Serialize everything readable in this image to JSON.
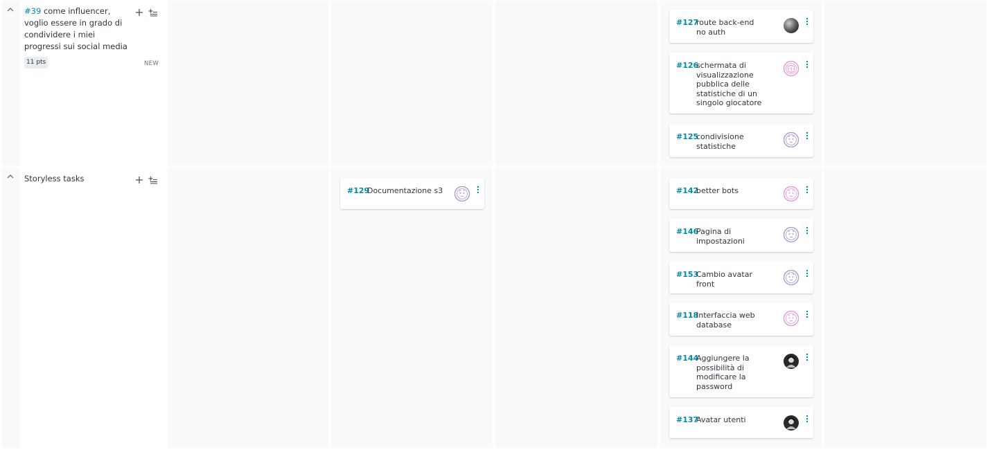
{
  "swimlanes": [
    {
      "story_ref": "#39",
      "story_title": "come influencer, voglio essere in grado di condividere i miei progressi sui social media",
      "points": "11 pts",
      "status": "NEW"
    },
    {
      "title": "Storyless tasks"
    }
  ],
  "cards": [
    {
      "ref": "#127",
      "title": "route back-end no auth",
      "avatar": "dark-sphere"
    },
    {
      "ref": "#126",
      "title": "schermata di visualizzazione pubblica delle statistiche di un singolo giocatore",
      "avatar": "pink-pattern"
    },
    {
      "ref": "#125",
      "title": "condivisione statistiche",
      "avatar": "lavender-face"
    },
    {
      "ref": "#129",
      "title": "Documentazione s3",
      "avatar": "lavender-face"
    },
    {
      "ref": "#142",
      "title": "better bots",
      "avatar": "pink-face"
    },
    {
      "ref": "#146",
      "title": "Pagina di impostazioni",
      "avatar": "lavender-face"
    },
    {
      "ref": "#153",
      "title": "Cambio avatar front",
      "avatar": "lavender-face"
    },
    {
      "ref": "#118",
      "title": "Interfaccia web database",
      "avatar": "pink-face"
    },
    {
      "ref": "#144",
      "title": "Aggiungere la possibilità di modificare la password",
      "avatar": "photo-person"
    },
    {
      "ref": "#137",
      "title": "Avatar utenti",
      "avatar": "photo-person"
    }
  ],
  "colors": {
    "accent": "#008aa6",
    "column_bg": "#f8f9fb",
    "divider": "#ffffff"
  }
}
